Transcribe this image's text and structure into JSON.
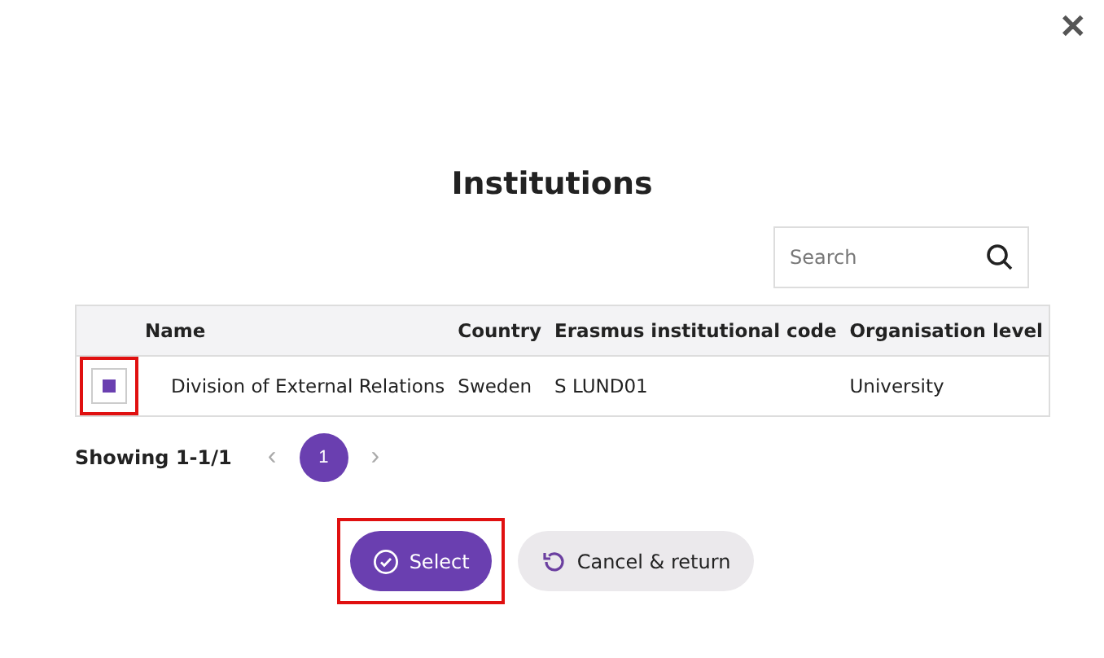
{
  "close_icon": "✕",
  "title": "Institutions",
  "search": {
    "placeholder": "Search"
  },
  "table": {
    "columns": [
      "Name",
      "Country",
      "Erasmus institutional code",
      "Organisation level"
    ],
    "rows": [
      {
        "checked": true,
        "highlighted": true,
        "cells": [
          "Division of External Relations",
          "Sweden",
          "S LUND01",
          "University"
        ]
      }
    ]
  },
  "pagination": {
    "summary": "Showing 1-1/1",
    "prev": "‹",
    "next": "›",
    "pages": [
      {
        "label": "1",
        "selected": true
      }
    ]
  },
  "buttons": [
    {
      "kind": "primary",
      "label": "Select",
      "highlighted": true
    },
    {
      "kind": "secondary",
      "label": "Cancel & return",
      "highlighted": false
    }
  ]
}
